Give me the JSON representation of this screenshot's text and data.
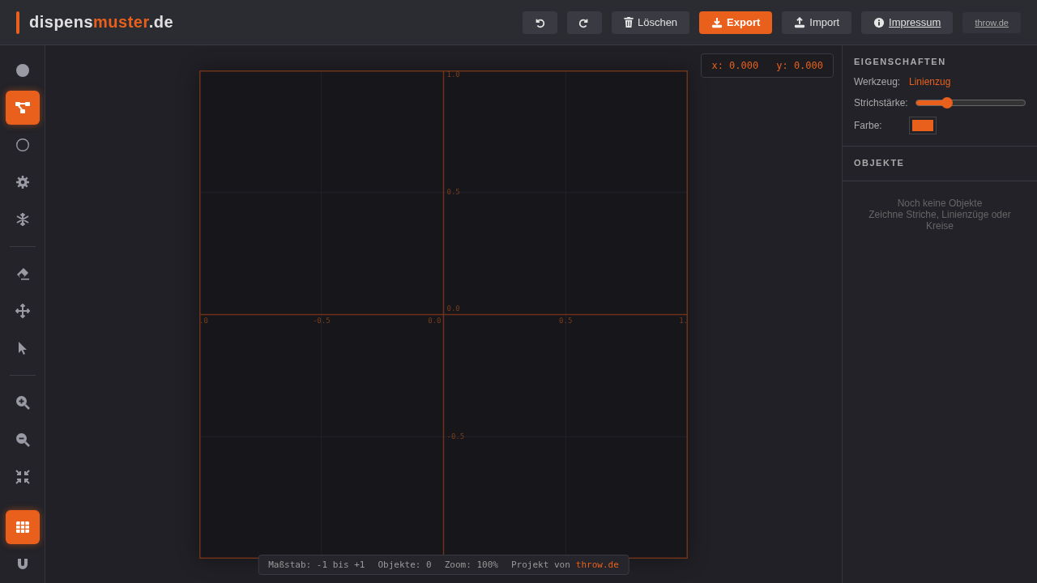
{
  "header": {
    "logo": {
      "part_1": "dispens",
      "part_2": "muster",
      "part_3": ".de"
    },
    "buttons": [
      {
        "kind": "undo"
      },
      {
        "kind": "redo"
      },
      {
        "kind": "delete",
        "label": "Löschen"
      },
      {
        "kind": "export",
        "label": "Export"
      },
      {
        "kind": "import",
        "label": "Import"
      },
      {
        "kind": "info",
        "label": "Impressum"
      },
      {
        "kind": "link",
        "label": "throw.de"
      }
    ]
  },
  "toolbar": {
    "groups": [
      [
        {
          "kind": "dot",
          "selected": false
        },
        {
          "kind": "polyline",
          "selected": true
        },
        {
          "kind": "circle",
          "selected": false
        },
        {
          "kind": "gear",
          "selected": false
        },
        {
          "kind": "snowflake",
          "selected": false
        }
      ],
      [
        {
          "kind": "eraser",
          "selected": false
        },
        {
          "kind": "move",
          "selected": false
        },
        {
          "kind": "pointer",
          "selected": false
        }
      ],
      [
        {
          "kind": "zoom-in",
          "selected": false
        },
        {
          "kind": "zoom-out",
          "selected": false
        },
        {
          "kind": "fit",
          "selected": false
        }
      ],
      [
        {
          "kind": "grid",
          "selected": true
        },
        {
          "kind": "magnet",
          "selected": false
        }
      ]
    ]
  },
  "canvas": {
    "x_labels": [
      ".0",
      "-0.5",
      "0.0",
      "0.5",
      "1."
    ],
    "y_labels": [
      "1.0",
      "0.5",
      "0.0",
      "-0.5"
    ],
    "coordinates": {
      "x": "x: 0.000",
      "y": "y: 0.000"
    },
    "status": {
      "scale": "Maßstab: -1 bis +1",
      "objects": "Objekte: 0",
      "zoom": "Zoom: 100%",
      "project": "Projekt von",
      "link": "throw.de"
    }
  },
  "properties": {
    "title": "EIGENSCHAFTEN",
    "tool_label": "Werkzeug:",
    "tool_value": "Linienzug",
    "stroke_label": "Strichstärke:",
    "stroke": {
      "level": 0.28
    },
    "color_label": "Farbe:",
    "color": "#e8601c"
  },
  "objects": {
    "title": "OBJEKTE",
    "empty_title": "Noch keine Objekte",
    "empty_hint": "Zeichne Striche, Linienzüge oder Kreise"
  }
}
